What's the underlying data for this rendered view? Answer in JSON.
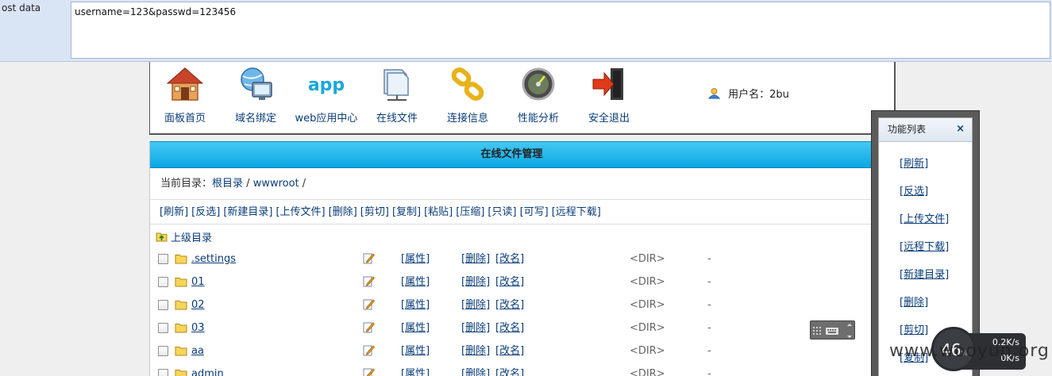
{
  "post": {
    "label": "ost data",
    "value": "username=123&passwd=123456"
  },
  "nav": {
    "items": [
      {
        "label": "面板首页",
        "icon": "house-icon"
      },
      {
        "label": "域名绑定",
        "icon": "globe-monitor-icon"
      },
      {
        "label": "web应用中心",
        "icon": "app-icon"
      },
      {
        "label": "在线文件",
        "icon": "folder-network-icon"
      },
      {
        "label": "连接信息",
        "icon": "chain-link-icon"
      },
      {
        "label": "性能分析",
        "icon": "gauge-icon"
      },
      {
        "label": "安全退出",
        "icon": "exit-door-icon"
      }
    ],
    "app_text": "app"
  },
  "user": {
    "label": "用户名：2bu"
  },
  "main": {
    "title": "在线文件管理",
    "breadcrumb_prefix": "当前目录：",
    "breadcrumb_root": "根目录",
    "breadcrumb_sep1": " / ",
    "breadcrumb_dir": "wwwroot",
    "breadcrumb_sep2": " /",
    "toolbar": [
      "[刷新]",
      "[反选]",
      "[新建目录]",
      "[上传文件]",
      "[删除]",
      "[剪切]",
      "[复制]",
      "[粘贴]",
      "[压缩]",
      "[只读]",
      "[可写]",
      "[远程下载]"
    ],
    "parent_dir": "上级目录",
    "row_attr": "[属性]",
    "row_delete": "[删除]",
    "row_rename": "[改名]",
    "rows": [
      {
        "name": ".settings",
        "type": "<DIR>",
        "size": "-"
      },
      {
        "name": "01",
        "type": "<DIR>",
        "size": "-"
      },
      {
        "name": "02",
        "type": "<DIR>",
        "size": "-"
      },
      {
        "name": "03",
        "type": "<DIR>",
        "size": "-"
      },
      {
        "name": "aa",
        "type": "<DIR>",
        "size": "-"
      },
      {
        "name": "admin",
        "type": "<DIR>",
        "size": "-"
      }
    ]
  },
  "fn_panel": {
    "title": "功能列表",
    "close": "×",
    "items": [
      "[刷新]",
      "[反选]",
      "[上传文件]",
      "[远程下载]",
      "[新建目录]",
      "[删除]",
      "[剪切]",
      "[复制]"
    ]
  },
  "speed": {
    "percent": "46",
    "pct_sign": "%",
    "up": "0.2K/s",
    "down": "0K/s"
  },
  "watermark": "www.wooyun.org",
  "colors": {
    "title_bar": "#0aa8e4",
    "link": "#0a3c78",
    "post_bg": "#d9e4f5"
  }
}
